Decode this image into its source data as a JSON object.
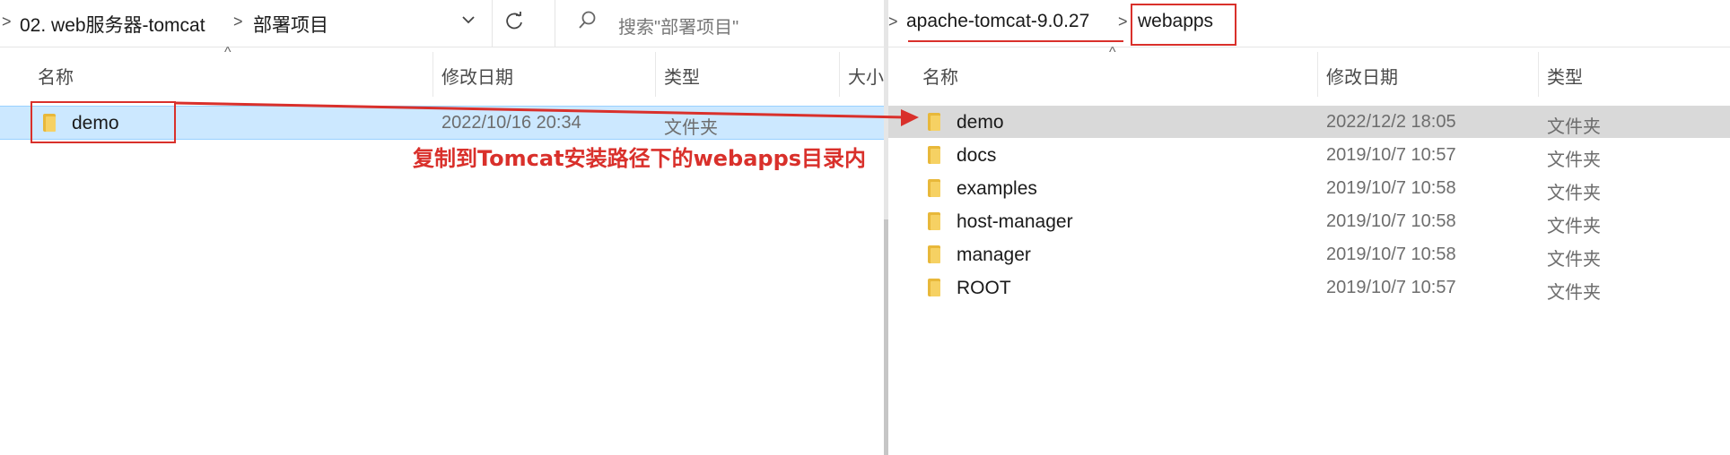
{
  "left": {
    "breadcrumb": [
      ">",
      "02. web服务器-tomcat",
      ">",
      "部署项目"
    ],
    "search_placeholder": "搜索\"部署项目\"",
    "columns": [
      "名称",
      "修改日期",
      "类型",
      "大小"
    ],
    "rows": [
      {
        "name": "demo",
        "date": "2022/10/16 20:34",
        "type": "文件夹"
      }
    ]
  },
  "right": {
    "breadcrumb": [
      ">",
      "apache-tomcat-9.0.27",
      ">",
      "webapps"
    ],
    "columns": [
      "名称",
      "修改日期",
      "类型"
    ],
    "rows": [
      {
        "name": "demo",
        "date": "2022/12/2 18:05",
        "type": "文件夹"
      },
      {
        "name": "docs",
        "date": "2019/10/7 10:57",
        "type": "文件夹"
      },
      {
        "name": "examples",
        "date": "2019/10/7 10:58",
        "type": "文件夹"
      },
      {
        "name": "host-manager",
        "date": "2019/10/7 10:58",
        "type": "文件夹"
      },
      {
        "name": "manager",
        "date": "2019/10/7 10:58",
        "type": "文件夹"
      },
      {
        "name": "ROOT",
        "date": "2019/10/7 10:57",
        "type": "文件夹"
      }
    ]
  },
  "annotation": "复制到Tomcat安装路径下的webapps目录内",
  "icons": {
    "dropdown": "chevron-down-icon",
    "refresh": "refresh-icon",
    "search": "search-icon",
    "folder": "folder-icon"
  },
  "colors": {
    "annotation": "#d9302b",
    "selection_left": "#cce8ff",
    "selection_right": "#d9d9d9",
    "folder": "#f6d163"
  }
}
